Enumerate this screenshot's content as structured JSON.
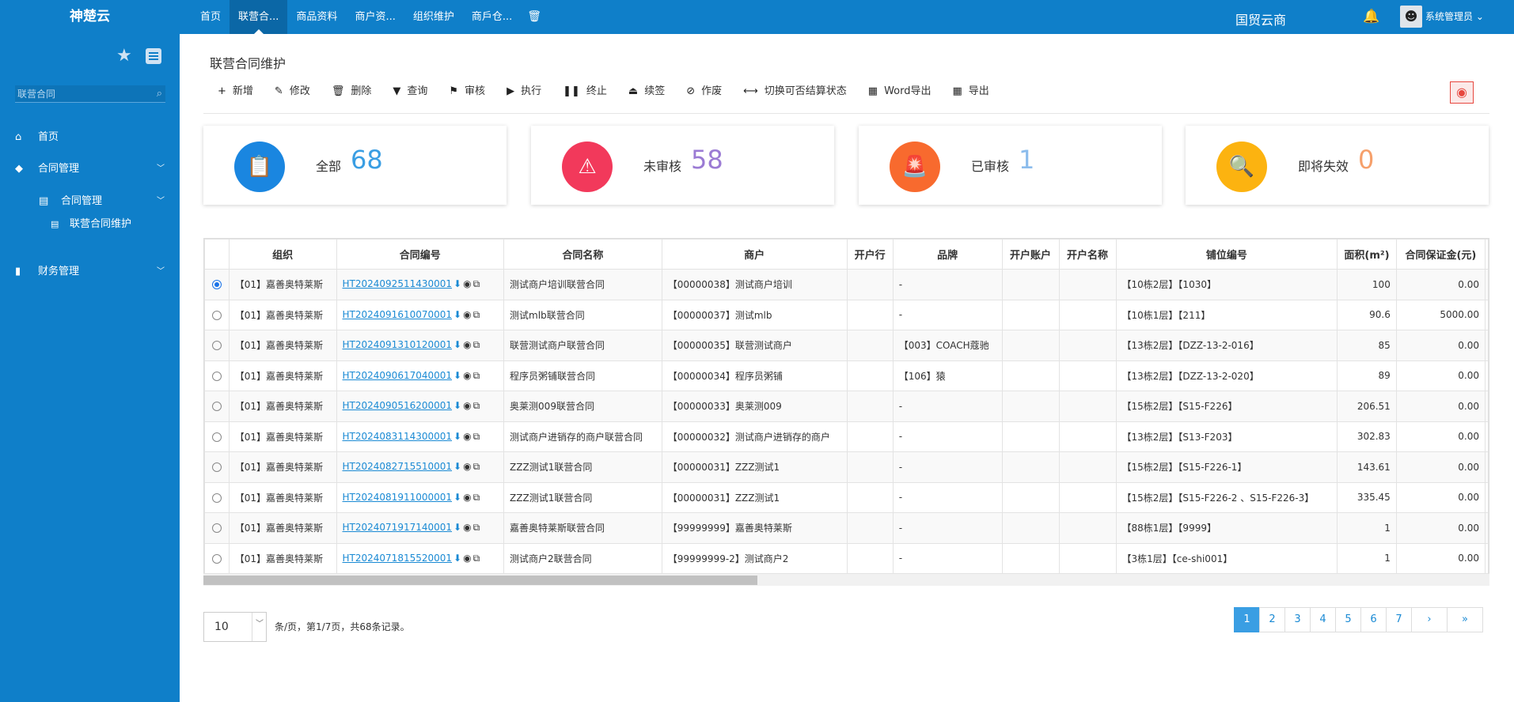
{
  "topbar": {
    "logo": "神楚云",
    "nav": [
      "首页",
      "联营合...",
      "商品资料",
      "商户资...",
      "组织维护",
      "商戶仓..."
    ],
    "brand": "国贸云商",
    "user": "系统管理员 ⌄",
    "trash_icon": "🗑",
    "bell_icon": "🔔"
  },
  "sidebar": {
    "search_placeholder": "联营合同",
    "home": "首页",
    "contract_mgmt": "合同管理",
    "contract_sub": "合同管理",
    "contract_maintain": "联营合同维护",
    "finance": "财务管理"
  },
  "page": {
    "title": "联营合同维护"
  },
  "toolbar": [
    {
      "icon": "+",
      "label": "新增"
    },
    {
      "icon": "✎",
      "label": "修改"
    },
    {
      "icon": "🗑",
      "label": "删除"
    },
    {
      "icon": "▼",
      "label": "查询"
    },
    {
      "icon": "⚑",
      "label": "审核"
    },
    {
      "icon": "▶",
      "label": "执行"
    },
    {
      "icon": "❚❚",
      "label": "终止"
    },
    {
      "icon": "⏏",
      "label": "续签"
    },
    {
      "icon": "⊘",
      "label": "作废"
    },
    {
      "icon": "⟷",
      "label": "切换可否结算状态"
    },
    {
      "icon": "▦",
      "label": "Word导出"
    },
    {
      "icon": "▦",
      "label": "导出"
    }
  ],
  "cards": [
    {
      "label": "全部",
      "value": "68",
      "icon": "📋",
      "bg": "#1a86e0",
      "num_color": "#3a9ee3"
    },
    {
      "label": "未审核",
      "value": "58",
      "icon": "⚠",
      "bg": "#f2395b",
      "num_color": "#9b7bd4"
    },
    {
      "label": "已审核",
      "value": "1",
      "icon": "🚨",
      "bg": "#f86a2e",
      "num_color": "#8bbcec"
    },
    {
      "label": "即将失效",
      "value": "0",
      "icon": "🔍",
      "bg": "#fcb310",
      "num_color": "#f6a06b"
    }
  ],
  "table": {
    "headers": [
      "组织",
      "合同编号",
      "合同名称",
      "商户",
      "开户行",
      "品牌",
      "开户账户",
      "开户名称",
      "铺位编号",
      "面积(m²)",
      "合同保证金(元)"
    ],
    "rows": [
      {
        "org": "【01】嘉善奥特莱斯",
        "code": "HT2024092511430001",
        "name": "测试商户培训联营合同",
        "merchant": "【00000038】测试商户培训",
        "bank": "",
        "brand": "-",
        "account": "",
        "acct_name": "",
        "booth": "【10栋2层】【1030】",
        "area": "100",
        "deposit": "0.00"
      },
      {
        "org": "【01】嘉善奥特莱斯",
        "code": "HT2024091610070001",
        "name": "测试mlb联营合同",
        "merchant": "【00000037】测试mlb",
        "bank": "",
        "brand": "-",
        "account": "",
        "acct_name": "",
        "booth": "【10栋1层】【211】",
        "area": "90.6",
        "deposit": "5000.00"
      },
      {
        "org": "【01】嘉善奥特莱斯",
        "code": "HT2024091310120001",
        "name": "联营测试商户联营合同",
        "merchant": "【00000035】联营测试商户",
        "bank": "",
        "brand": "【003】COACH蔻驰",
        "account": "",
        "acct_name": "",
        "booth": "【13栋2层】【DZZ-13-2-016】",
        "area": "85",
        "deposit": "0.00"
      },
      {
        "org": "【01】嘉善奥特莱斯",
        "code": "HT2024090617040001",
        "name": "程序员粥铺联营合同",
        "merchant": "【00000034】程序员粥铺",
        "bank": "",
        "brand": "【106】猿",
        "account": "",
        "acct_name": "",
        "booth": "【13栋2层】【DZZ-13-2-020】",
        "area": "89",
        "deposit": "0.00"
      },
      {
        "org": "【01】嘉善奥特莱斯",
        "code": "HT2024090516200001",
        "name": "奥莱测009联营合同",
        "merchant": "【00000033】奥莱测009",
        "bank": "",
        "brand": "-",
        "account": "",
        "acct_name": "",
        "booth": "【15栋2层】【S15-F226】",
        "area": "206.51",
        "deposit": "0.00"
      },
      {
        "org": "【01】嘉善奥特莱斯",
        "code": "HT2024083114300001",
        "name": "测试商户进销存的商户联营合同",
        "merchant": "【00000032】测试商户进销存的商户",
        "bank": "",
        "brand": "-",
        "account": "",
        "acct_name": "",
        "booth": "【13栋2层】【S13-F203】",
        "area": "302.83",
        "deposit": "0.00"
      },
      {
        "org": "【01】嘉善奥特莱斯",
        "code": "HT2024082715510001",
        "name": "ZZZ测试1联营合同",
        "merchant": "【00000031】ZZZ测试1",
        "bank": "",
        "brand": "-",
        "account": "",
        "acct_name": "",
        "booth": "【15栋2层】【S15-F226-1】",
        "area": "143.61",
        "deposit": "0.00"
      },
      {
        "org": "【01】嘉善奥特莱斯",
        "code": "HT2024081911000001",
        "name": "ZZZ测试1联营合同",
        "merchant": "【00000031】ZZZ测试1",
        "bank": "",
        "brand": "-",
        "account": "",
        "acct_name": "",
        "booth": "【15栋2层】【S15-F226-2 、S15-F226-3】",
        "area": "335.45",
        "deposit": "0.00"
      },
      {
        "org": "【01】嘉善奥特莱斯",
        "code": "HT2024071917140001",
        "name": "嘉善奥特莱斯联营合同",
        "merchant": "【99999999】嘉善奥特莱斯",
        "bank": "",
        "brand": "-",
        "account": "",
        "acct_name": "",
        "booth": "【88栋1层】【9999】",
        "area": "1",
        "deposit": "0.00"
      },
      {
        "org": "【01】嘉善奥特莱斯",
        "code": "HT2024071815520001",
        "name": "测试商户2联营合同",
        "merchant": "【99999999-2】测试商户2",
        "bank": "",
        "brand": "-",
        "account": "",
        "acct_name": "",
        "booth": "【3栋1层】【ce-shi001】",
        "area": "1",
        "deposit": "0.00"
      }
    ],
    "selected_row": 0
  },
  "pagination": {
    "page_size": "10",
    "info": "条/页，第1/7页，共68条记录。",
    "pages": [
      "1",
      "2",
      "3",
      "4",
      "5",
      "6",
      "7"
    ],
    "next": "›",
    "last": "»",
    "current": "1"
  }
}
